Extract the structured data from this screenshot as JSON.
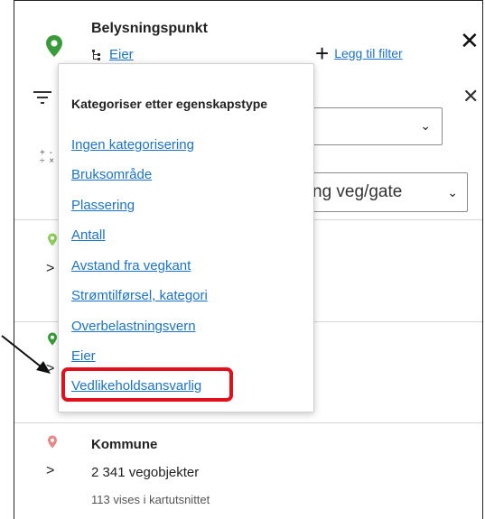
{
  "header": {
    "title": "Belysningspunkt",
    "owner_link": "Eier",
    "add_filter_label": "Legg til filter",
    "close_symbol": "✕"
  },
  "filter_row": {
    "close_symbol": "✕",
    "select_1_value": "",
    "select_2_value": "ng veg/gate"
  },
  "dropdown": {
    "heading": "Kategoriser etter egenskapstype",
    "items": [
      "Ingen kategorisering",
      "Bruksområde",
      "Plassering",
      "Antall",
      "Avstand fra vegkant",
      "Strømtilførsel, kategori",
      "Overbelastningsvern",
      "Eier",
      "Vedlikeholdsansvarlig"
    ],
    "highlighted_item": "Vedlikeholdsansvarlig"
  },
  "list": {
    "kommune_row": {
      "name": "Kommune",
      "count": "2 341 vegobjekter",
      "visible": "113 vises i kartutsnittet"
    }
  },
  "colors": {
    "link": "#1a73c8",
    "highlight": "#e0101c",
    "pin_green": "#3a9b3a",
    "pin_light_green": "#8fcf5a",
    "pin_red": "#e88888"
  },
  "icons": {
    "header_pin": "map-pin-icon",
    "hierarchy": "hierarchy-icon",
    "plus": "plus-icon",
    "filter": "filter-icon",
    "chevron": "chevron-right-icon"
  }
}
